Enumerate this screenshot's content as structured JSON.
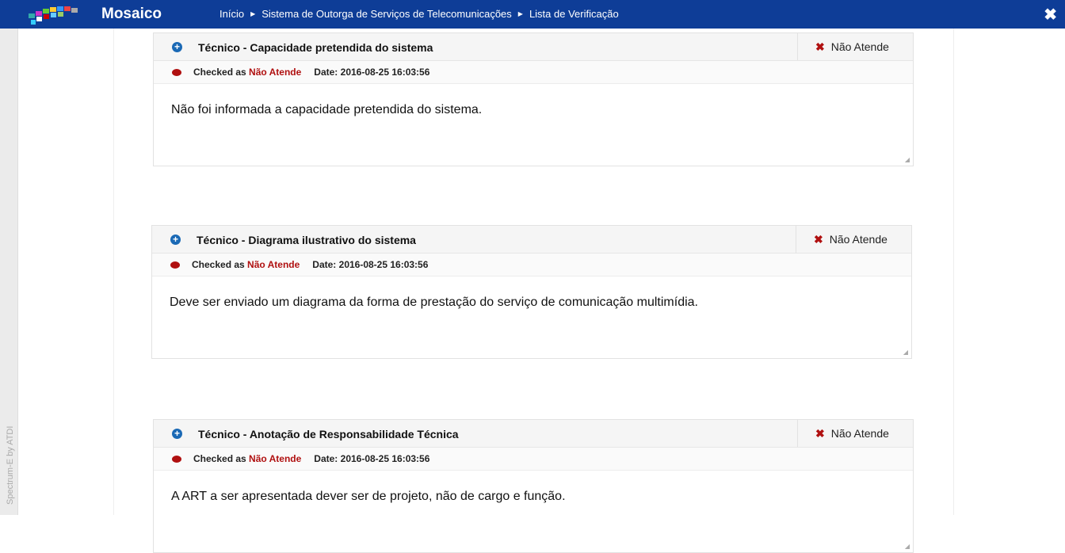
{
  "app": {
    "title": "Mosaico",
    "close_icon": "close-icon"
  },
  "breadcrumb": [
    "Início",
    "Sistema de Outorga de Serviços de Telecomunicações",
    "Lista de Verificação"
  ],
  "sidebar": {
    "credit": "Spectrum-E by ATDI"
  },
  "colors": {
    "topbar": "#0e3d97",
    "status_red": "#b01010",
    "icon_blue": "#1a69b5"
  },
  "labels": {
    "checked_as": "Checked as",
    "date": "Date:"
  },
  "panels": [
    {
      "title": "Técnico - Capacidade pretendida do sistema",
      "status": "Não Atende",
      "checked": "Não Atende",
      "date": "2016-08-25 16:03:56",
      "comment": "Não foi informada a capacidade pretendida do sistema."
    },
    {
      "title": "Técnico - Diagrama ilustrativo do sistema",
      "status": "Não Atende",
      "checked": "Não Atende",
      "date": "2016-08-25 16:03:56",
      "comment": "Deve ser enviado um diagrama da forma de prestação do serviço de comunicação multimídia."
    },
    {
      "title": "Técnico - Anotação de Responsabilidade Técnica",
      "status": "Não Atende",
      "checked": "Não Atende",
      "date": "2016-08-25 16:03:56",
      "comment": "A ART a ser apresentada dever ser de projeto, não de cargo e função."
    }
  ]
}
